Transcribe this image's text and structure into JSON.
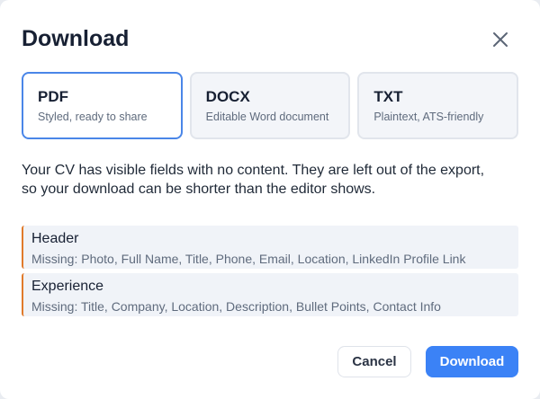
{
  "dialog": {
    "title": "Download",
    "close_icon": "close-icon"
  },
  "formats": [
    {
      "name": "PDF",
      "description": "Styled, ready to share",
      "selected": true
    },
    {
      "name": "DOCX",
      "description": "Editable Word document",
      "selected": false
    },
    {
      "name": "TXT",
      "description": "Plaintext, ATS-friendly",
      "selected": false
    }
  ],
  "notice": "Your CV has visible fields with no content. They are left out of the export, so your download can be shorter than the editor shows.",
  "missing": [
    {
      "section": "Header",
      "fields": "Missing: Photo, Full Name, Title, Phone, Email, Location, LinkedIn Profile Link"
    },
    {
      "section": "Experience",
      "fields": "Missing: Title, Company, Location, Description, Bullet Points, Contact Info"
    }
  ],
  "buttons": {
    "cancel": "Cancel",
    "download": "Download"
  },
  "colors": {
    "accent": "#3b82f6",
    "selected_border": "#4a86e8",
    "warning_stripe": "#e07a2b"
  }
}
